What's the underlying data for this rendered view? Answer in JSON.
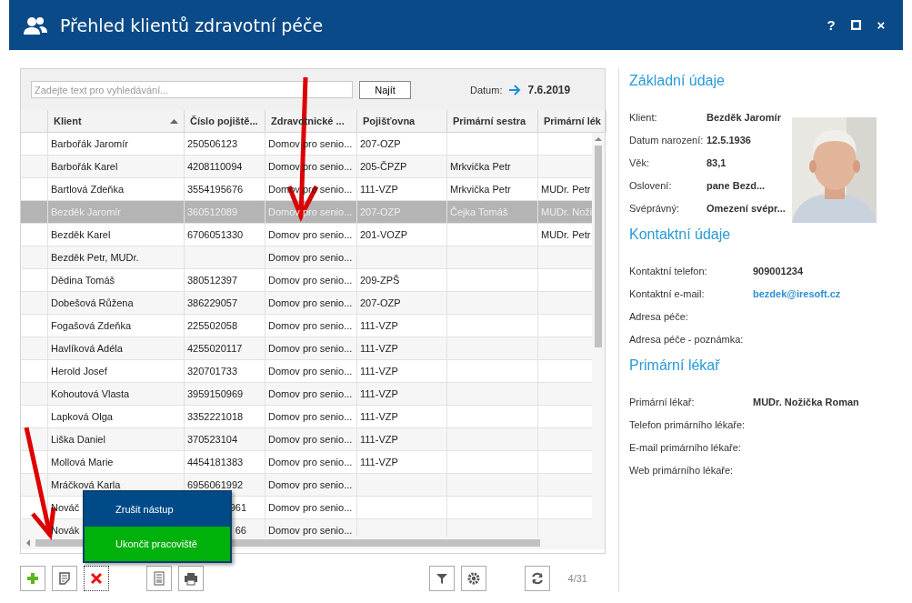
{
  "window": {
    "title": "Přehled klientů zdravotní péče",
    "controls": [
      "?",
      "×"
    ]
  },
  "search": {
    "placeholder": "Zadejte text pro vyhledávání...",
    "button": "Najít",
    "date_label": "Datum:",
    "date": "7.6.2019"
  },
  "table": {
    "columns": [
      {
        "label": "Klient",
        "sorted": true
      },
      {
        "label": "Číslo pojiště...",
        "sorted": false
      },
      {
        "label": "Zdravotnické ...",
        "sorted": false
      },
      {
        "label": "Pojišťovna",
        "sorted": false
      },
      {
        "label": "Primární sestra",
        "sorted": false
      },
      {
        "label": "Primární lék",
        "sorted": false
      }
    ],
    "rows": [
      {
        "cells": [
          "Barbořák Jaromír",
          "250506123",
          "Domov pro senio...",
          "207-OZP",
          "",
          ""
        ],
        "selected": false
      },
      {
        "cells": [
          "Barbořák Karel",
          "4208110094",
          "Domov pro senio...",
          "205-ČPZP",
          "Mrkvička Petr",
          ""
        ],
        "selected": false
      },
      {
        "cells": [
          "Bartlová Zdeňka",
          "3554195676",
          "Domov pro senio...",
          "111-VZP",
          "Mrkvička Petr",
          "MUDr. Petr"
        ],
        "selected": false
      },
      {
        "cells": [
          "Bezděk Jaromír",
          "360512089",
          "Domov pro senio...",
          "207-OZP",
          "Čejka Tomáš",
          "MUDr. Noži"
        ],
        "selected": true
      },
      {
        "cells": [
          "Bezděk Karel",
          "6706051330",
          "Domov pro senio...",
          "201-VOZP",
          "",
          "MUDr. Petr"
        ],
        "selected": false
      },
      {
        "cells": [
          "Bezděk Petr, MUDr.",
          "",
          "Domov pro senio...",
          "",
          "",
          ""
        ],
        "selected": false
      },
      {
        "cells": [
          "Dědina Tomáš",
          "380512397",
          "Domov pro senio...",
          "209-ZPŠ",
          "",
          ""
        ],
        "selected": false
      },
      {
        "cells": [
          "Dobešová Růžena",
          "386229057",
          "Domov pro senio...",
          "207-OZP",
          "",
          ""
        ],
        "selected": false
      },
      {
        "cells": [
          "Fogašová Zdeňka",
          "225502058",
          "Domov pro senio...",
          "111-VZP",
          "",
          ""
        ],
        "selected": false
      },
      {
        "cells": [
          "Havlíková Adéla",
          "4255020117",
          "Domov pro senio...",
          "111-VZP",
          "",
          ""
        ],
        "selected": false
      },
      {
        "cells": [
          "Herold Josef",
          "320701733",
          "Domov pro senio...",
          "111-VZP",
          "",
          ""
        ],
        "selected": false
      },
      {
        "cells": [
          "Kohoutová Vlasta",
          "3959150969",
          "Domov pro senio...",
          "111-VZP",
          "",
          ""
        ],
        "selected": false
      },
      {
        "cells": [
          "Lapková Olga",
          "3352221018",
          "Domov pro senio...",
          "111-VZP",
          "",
          ""
        ],
        "selected": false
      },
      {
        "cells": [
          "Liška Daniel",
          "370523104",
          "Domov pro senio...",
          "111-VZP",
          "",
          ""
        ],
        "selected": false
      },
      {
        "cells": [
          "Mollová Marie",
          "4454181383",
          "Domov pro senio...",
          "111-VZP",
          "",
          ""
        ],
        "selected": false
      },
      {
        "cells": [
          "Mráčková Karla",
          "6956061992",
          "Domov pro senio...",
          "",
          "",
          ""
        ],
        "selected": false
      },
      {
        "cells": [
          "Nováč",
          "961",
          "Domov pro senio...",
          "",
          "",
          ""
        ],
        "selected": false,
        "covered": true
      },
      {
        "cells": [
          "Novák",
          "66",
          "Domov pro senio...",
          "",
          "",
          ""
        ],
        "selected": false,
        "covered": true
      }
    ]
  },
  "popup_menu": [
    {
      "label": "Zrušit nástup",
      "kind": "normal"
    },
    {
      "label": "Ukončit pracoviště",
      "kind": "highlight"
    }
  ],
  "toolbar": {
    "count": "4/31"
  },
  "details": [
    {
      "heading": "Základní údaje",
      "fields": [
        {
          "label": "Klient:",
          "value": "Bezděk Jaromír"
        },
        {
          "label": "Datum narození:",
          "value": "12.5.1936"
        },
        {
          "label": "Věk:",
          "value": "83,1"
        },
        {
          "label": "Oslovení:",
          "value": "pane Bezd..."
        },
        {
          "label": "Svéprávný:",
          "value": "Omezení svépr..."
        }
      ],
      "photo": {
        "kind": "picture"
      }
    },
    {
      "heading": "Kontaktní údaje",
      "fields": [
        {
          "label": "Kontaktní telefon:",
          "value": "909001234"
        },
        {
          "label": "Kontaktní e-mail:",
          "value": "bezdek@iresoft.cz",
          "kind": "link"
        },
        {
          "label": "Adresa péče:"
        },
        {
          "label": "Adresa péče - poznámka:"
        }
      ]
    },
    {
      "heading": "Primární lékař",
      "fields": [
        {
          "label": "Primární lékař:",
          "value": "MUDr. Nožička Roman"
        },
        {
          "label": "Telefon primárního lékaře:"
        },
        {
          "label": "E-mail primárního lékaře:"
        },
        {
          "label": "Web primárního lékaře:"
        }
      ]
    }
  ]
}
